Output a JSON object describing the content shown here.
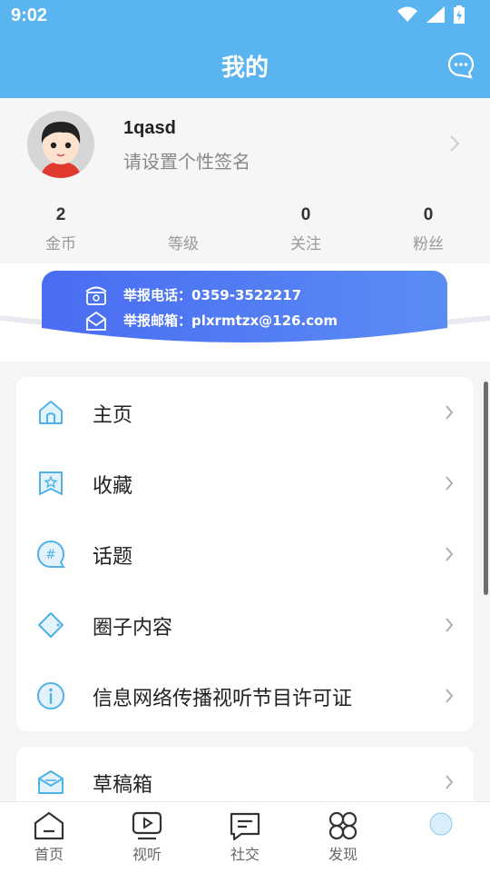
{
  "status_bar": {
    "time": "9:02"
  },
  "header": {
    "title": "我的",
    "message_icon": "chat-bubble-icon"
  },
  "profile": {
    "username": "1qasd",
    "signature": "请设置个性签名",
    "stats": [
      {
        "value": "2",
        "label": "金币"
      },
      {
        "value": "",
        "label": "等级"
      },
      {
        "value": "0",
        "label": "关注"
      },
      {
        "value": "0",
        "label": "粉丝"
      }
    ]
  },
  "banner": {
    "phone": "举报电话：0359-3522217",
    "email": "举报邮箱：plxrmtzx@126.com"
  },
  "menu": [
    {
      "label": "主页",
      "icon": "home-icon"
    },
    {
      "label": "收藏",
      "icon": "bookmark-star-icon"
    },
    {
      "label": "话题",
      "icon": "hashtag-icon"
    },
    {
      "label": "圈子内容",
      "icon": "diamond-icon"
    },
    {
      "label": "信息网络传播视听节目许可证",
      "icon": "info-icon"
    }
  ],
  "menu2": [
    {
      "label": "草稿箱",
      "icon": "drafts-icon"
    }
  ],
  "tabs": [
    {
      "label": "首页",
      "icon": "home-tab-icon"
    },
    {
      "label": "视听",
      "icon": "video-tab-icon"
    },
    {
      "label": "社交",
      "icon": "social-tab-icon"
    },
    {
      "label": "发现",
      "icon": "discover-tab-icon"
    },
    {
      "label": "",
      "icon": "profile-tab-icon"
    }
  ],
  "colors": {
    "brand": "#5ab4f0",
    "banner": "#4a6cf3",
    "icon_accent": "#4fb3e8"
  }
}
